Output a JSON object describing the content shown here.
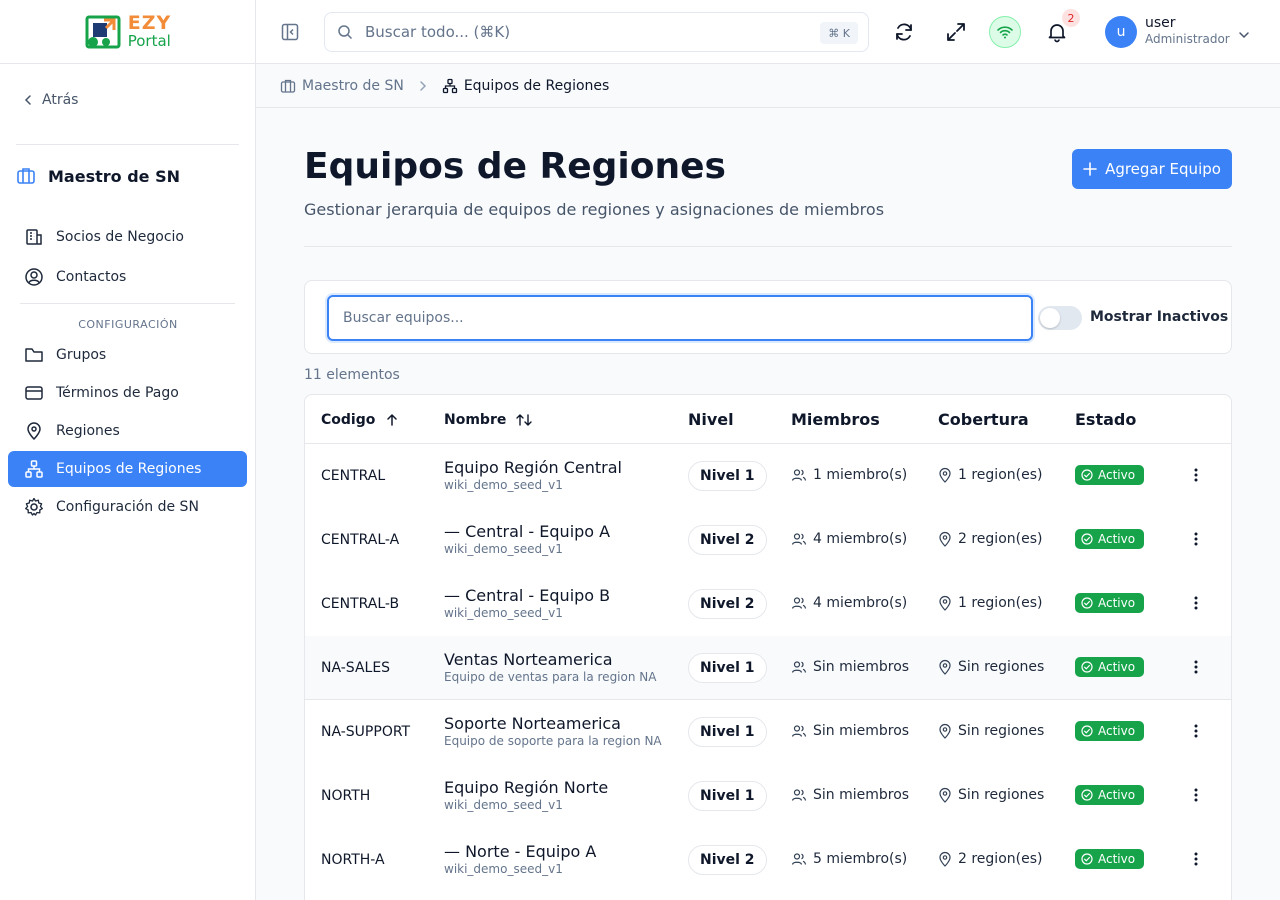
{
  "brand": {
    "logo_top": "EZY",
    "logo_bottom": "Portal"
  },
  "sidebar": {
    "back_label": "Atrás",
    "module_title": "Maestro de SN",
    "items_top": [
      {
        "label": "Socios de Negocio",
        "icon": "building-icon"
      },
      {
        "label": "Contactos",
        "icon": "user-circle-icon"
      }
    ],
    "section_label": "CONFIGURACIÓN",
    "items_config": [
      {
        "label": "Grupos",
        "icon": "folder-icon"
      },
      {
        "label": "Términos de Pago",
        "icon": "credit-card-icon"
      },
      {
        "label": "Regiones",
        "icon": "map-pin-icon"
      },
      {
        "label": "Equipos de Regiones",
        "icon": "network-icon",
        "active": true
      },
      {
        "label": "Configuración de SN",
        "icon": "gear-icon"
      }
    ]
  },
  "header": {
    "search_placeholder": "Buscar todo... (⌘K)",
    "search_shortcut": "⌘ K",
    "notifications_count": "2",
    "user_initial": "u",
    "user_name": "user",
    "user_role": "Administrador"
  },
  "breadcrumb": {
    "parent": "Maestro de SN",
    "current": "Equipos de Regiones"
  },
  "page": {
    "title": "Equipos de Regiones",
    "subtitle": "Gestionar jerarquia de equipos de regiones y asignaciones de miembros",
    "add_button": "Agregar Equipo",
    "search_placeholder": "Buscar equipos...",
    "show_inactive_label": "Mostrar Inactivos",
    "show_inactive_on": false,
    "count_text": "11 elementos"
  },
  "table": {
    "columns": {
      "code": "Codigo",
      "name": "Nombre",
      "level": "Nivel",
      "members": "Miembros",
      "coverage": "Cobertura",
      "status": "Estado"
    },
    "rows": [
      {
        "code": "CENTRAL",
        "name": "Equipo Región Central",
        "desc": "wiki_demo_seed_v1",
        "level": "Nivel 1",
        "members": "1 miembro(s)",
        "coverage": "1 region(es)",
        "status": "Activo"
      },
      {
        "code": "CENTRAL-A",
        "name": "— Central - Equipo A",
        "desc": "wiki_demo_seed_v1",
        "level": "Nivel 2",
        "members": "4 miembro(s)",
        "coverage": "2 region(es)",
        "status": "Activo"
      },
      {
        "code": "CENTRAL-B",
        "name": "— Central - Equipo B",
        "desc": "wiki_demo_seed_v1",
        "level": "Nivel 2",
        "members": "4 miembro(s)",
        "coverage": "1 region(es)",
        "status": "Activo"
      },
      {
        "code": "NA-SALES",
        "name": "Ventas Norteamerica",
        "desc": "Equipo de ventas para la region NA",
        "level": "Nivel 1",
        "members": "Sin miembros",
        "coverage": "Sin regiones",
        "status": "Activo"
      },
      {
        "code": "NA-SUPPORT",
        "name": "Soporte Norteamerica",
        "desc": "Equipo de soporte para la region NA",
        "level": "Nivel 1",
        "members": "Sin miembros",
        "coverage": "Sin regiones",
        "status": "Activo"
      },
      {
        "code": "NORTH",
        "name": "Equipo Región Norte",
        "desc": "wiki_demo_seed_v1",
        "level": "Nivel 1",
        "members": "Sin miembros",
        "coverage": "Sin regiones",
        "status": "Activo"
      },
      {
        "code": "NORTH-A",
        "name": "— Norte - Equipo A",
        "desc": "wiki_demo_seed_v1",
        "level": "Nivel 2",
        "members": "5 miembro(s)",
        "coverage": "2 region(es)",
        "status": "Activo"
      }
    ]
  },
  "colors": {
    "accent": "#3b82f6",
    "status_active": "#16a34a",
    "logo_orange": "#f28c38",
    "logo_green": "#16a34a"
  }
}
